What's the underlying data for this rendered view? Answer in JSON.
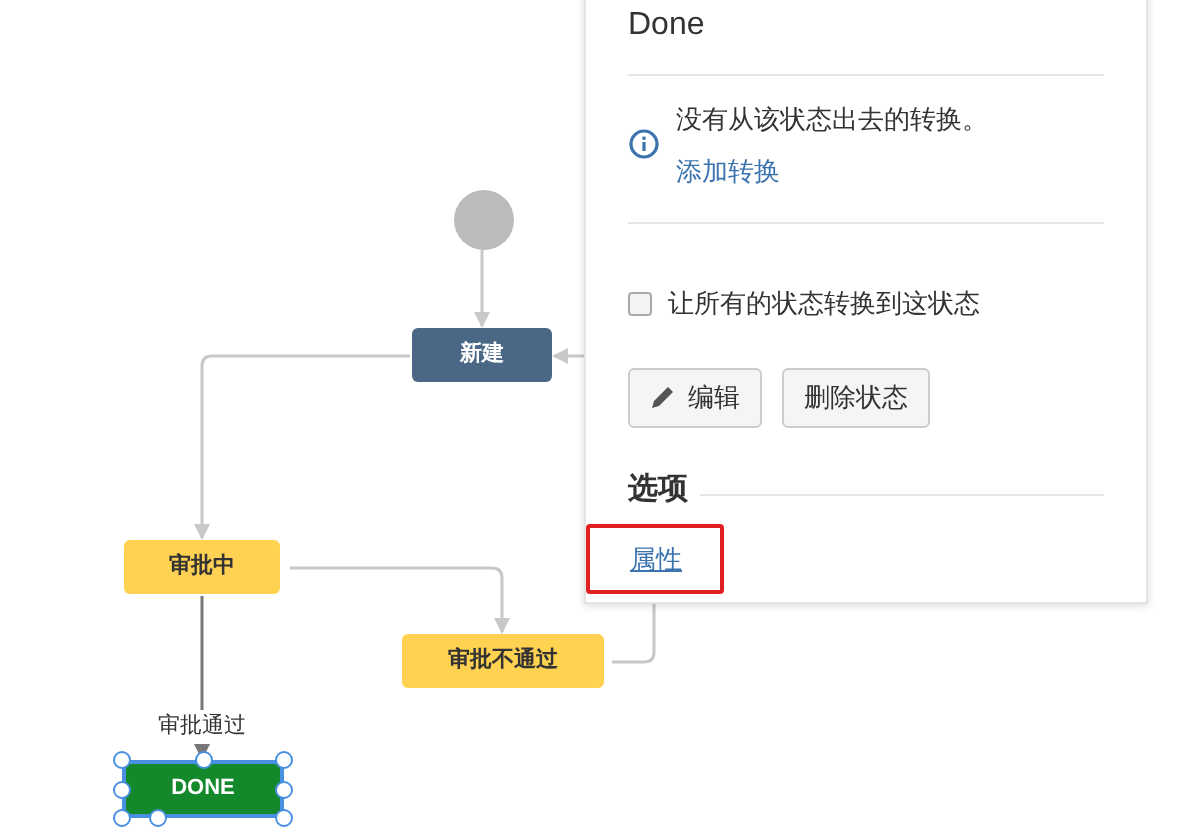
{
  "diagram": {
    "nodes": [
      {
        "kind": "start",
        "selected": false
      },
      {
        "kind": "status",
        "label": "新建",
        "color": "#4a6785",
        "selected": false
      },
      {
        "kind": "status",
        "label": "审批中",
        "color": "#ffd351",
        "selected": false
      },
      {
        "kind": "status",
        "label": "审批不通过",
        "color": "#ffd351",
        "selected": false
      },
      {
        "kind": "status",
        "label": "DONE",
        "color": "#14892c",
        "selected": true
      }
    ],
    "transition_label": "审批通过"
  },
  "panel": {
    "title": "Done",
    "info_message": "没有从该状态出去的转换。",
    "add_transition_link": "添加转换",
    "checkbox": {
      "label": "让所有的状态转换到这状态",
      "checked": false
    },
    "buttons": [
      {
        "kind": "edit",
        "label": "编辑"
      },
      {
        "kind": "plain",
        "label": "删除状态"
      }
    ],
    "section_heading": "选项",
    "properties_link": {
      "label": "属性",
      "highlighted": true
    }
  }
}
